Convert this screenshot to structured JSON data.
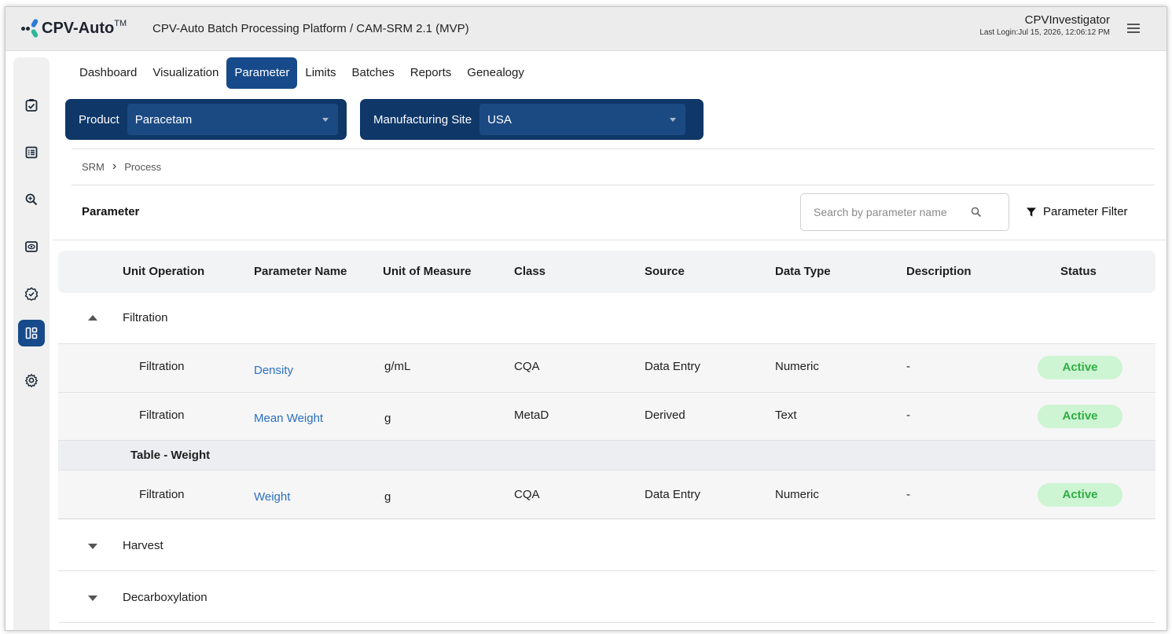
{
  "header": {
    "logo_text": "CPV-Auto",
    "logo_sup": "TM",
    "app_title": "CPV-Auto Batch Processing Platform / CAM-SRM 2.1 (MVP)",
    "user_name": "CPVInvestigator",
    "last_login": "Last Login:Jul 15, 2026, 12:06:12 PM"
  },
  "sidebar": {
    "items": [
      {
        "icon": "checklist-icon"
      },
      {
        "icon": "document-list-icon"
      },
      {
        "icon": "zoom-search-icon"
      },
      {
        "icon": "eye-monitor-icon"
      },
      {
        "icon": "verified-badge-icon"
      },
      {
        "icon": "dashboard-layout-icon",
        "active": true
      },
      {
        "icon": "gear-icon"
      }
    ]
  },
  "nav": {
    "tabs": [
      {
        "label": "Dashboard"
      },
      {
        "label": "Visualization"
      },
      {
        "label": "Parameter",
        "active": true
      },
      {
        "label": "Limits"
      },
      {
        "label": "Batches"
      },
      {
        "label": "Reports"
      },
      {
        "label": "Genealogy"
      }
    ]
  },
  "filters": {
    "product_label": "Product",
    "product_value": "Paracetam",
    "site_label": "Manufacturing Site",
    "site_value": "USA"
  },
  "breadcrumb": {
    "items": [
      "SRM",
      "Process"
    ]
  },
  "section": {
    "title": "Parameter",
    "search_placeholder": "Search by parameter name",
    "filter_label": "Parameter Filter"
  },
  "table": {
    "headers": [
      "Unit Operation",
      "Parameter Name",
      "Unit of Measure",
      "Class",
      "Source",
      "Data Type",
      "Description",
      "Status"
    ],
    "groups": [
      {
        "name": "Filtration",
        "expanded": true,
        "rows": [
          {
            "unit_operation": "Filtration",
            "parameter": "Density",
            "uom": "g/mL",
            "class": "CQA",
            "source": "Data Entry",
            "data_type": "Numeric",
            "description": "-",
            "status": "Active"
          },
          {
            "unit_operation": "Filtration",
            "parameter": "Mean Weight",
            "uom": "g",
            "class": "MetaD",
            "source": "Derived",
            "data_type": "Text",
            "description": "-",
            "status": "Active"
          }
        ],
        "subtable": {
          "title": "Table - Weight",
          "rows": [
            {
              "unit_operation": "Filtration",
              "parameter": "Weight",
              "uom": "g",
              "class": "CQA",
              "source": "Data Entry",
              "data_type": "Numeric",
              "description": "-",
              "status": "Active"
            }
          ]
        }
      },
      {
        "name": "Harvest",
        "expanded": false
      },
      {
        "name": "Decarboxylation",
        "expanded": false
      }
    ]
  },
  "colors": {
    "primary": "#174a8a",
    "selector_bg": "#0f3768",
    "link": "#2a6fc0",
    "status_bg": "#cdf4d3",
    "status_text": "#2fae43"
  }
}
